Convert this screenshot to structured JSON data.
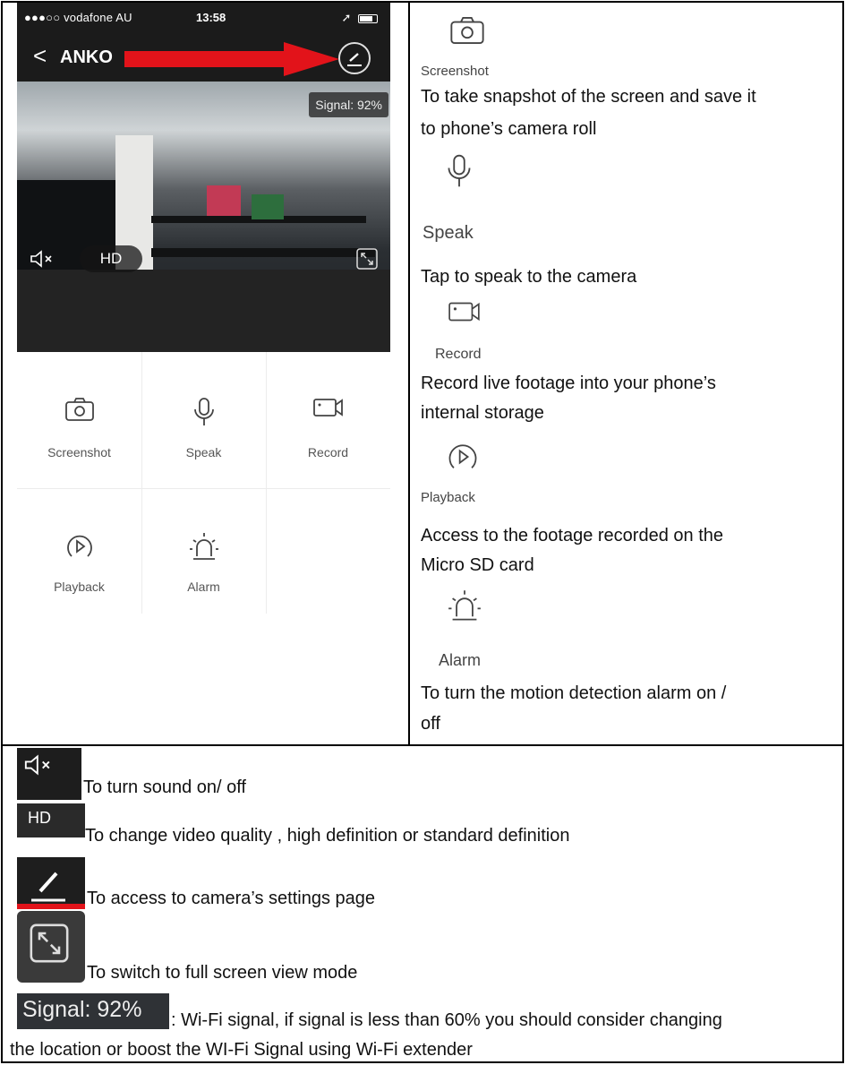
{
  "status_bar": {
    "carrier": "●●●○○ vodafone AU",
    "time": "13:58"
  },
  "nav": {
    "back": "<",
    "title": "ANKO"
  },
  "video": {
    "signal": "Signal: 92%",
    "quality": "HD"
  },
  "controls": [
    {
      "label": "Screenshot",
      "icon": "camera-icon"
    },
    {
      "label": "Speak",
      "icon": "microphone-icon"
    },
    {
      "label": "Record",
      "icon": "video-camera-icon"
    },
    {
      "label": "Playback",
      "icon": "playback-icon"
    },
    {
      "label": "Alarm",
      "icon": "alarm-siren-icon"
    }
  ],
  "descriptions": {
    "screenshot": {
      "label": "Screenshot",
      "line1": "To take snapshot of the screen and save it",
      "line2": "to phone’s camera roll"
    },
    "speak": {
      "label": "Speak",
      "text": "Tap to speak to the camera"
    },
    "record": {
      "label": "Record",
      "line1": "Record live footage into your phone’s",
      "line2": "internal storage"
    },
    "playback": {
      "label": "Playback",
      "line1": "Access to the footage recorded on the",
      "line2": "Micro SD card"
    },
    "alarm": {
      "label": "Alarm",
      "line1": "To turn the motion detection alarm on /",
      "line2": "off"
    }
  },
  "legend": {
    "sound": "To turn sound on/ off",
    "hd_badge": "HD",
    "hd": "To change video quality , high definition or standard definition",
    "settings": "To access to camera’s settings page",
    "fullscreen": "To switch to full screen view mode",
    "signal_badge": "Signal: 92%",
    "signal_line1": ": Wi-Fi signal, if signal is less than 60% you should consider changing",
    "signal_line2": "the location or boost the WI-Fi Signal using Wi-Fi extender"
  },
  "colors": {
    "accent_red": "#e2131a",
    "dark_bar": "#1b1b1b"
  }
}
